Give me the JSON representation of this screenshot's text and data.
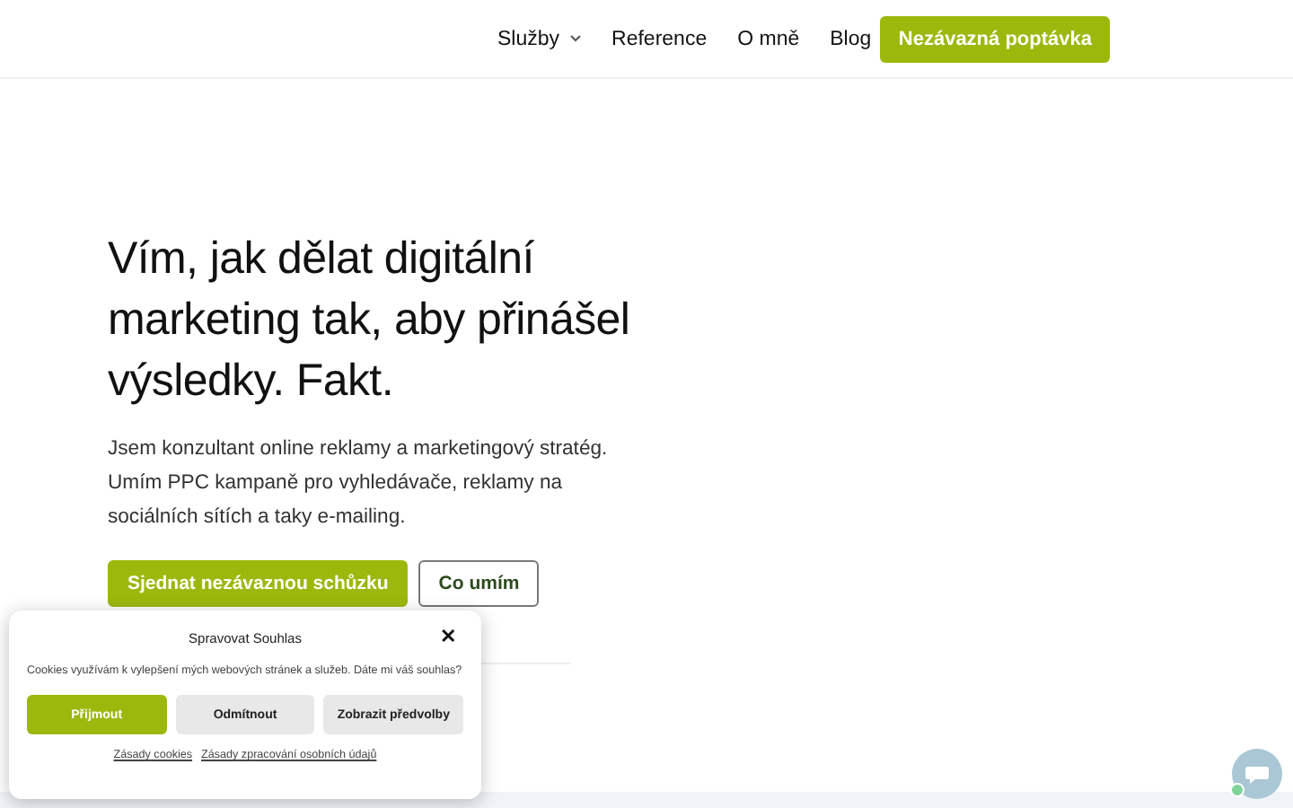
{
  "nav": {
    "items": [
      {
        "label": "Služby",
        "dropdown": true
      },
      {
        "label": "Reference",
        "dropdown": false
      },
      {
        "label": "O mně",
        "dropdown": false
      },
      {
        "label": "Blog",
        "dropdown": false
      }
    ],
    "cta": "Nezávazná poptávka"
  },
  "hero": {
    "heading": "Vím, jak dělat digitální marketing tak, aby přinášel výsledky. Fakt.",
    "text": "Jsem konzultant online reklamy a marketingový stratég. Umím PPC kampaně pro vyhledávače, reklamy na sociálních sítích a taky e-mailing.",
    "buttons": [
      {
        "label": "Sjednat nezávaznou schůzku",
        "kind": "primary"
      },
      {
        "label": "Co umím",
        "kind": "outline"
      }
    ]
  },
  "cookie_dialog": {
    "title": "Spravovat Souhlas",
    "close": "✕",
    "text": "Cookies využívám k vylepšení mých webových stránek a služeb. Dáte mi váš souhlas?",
    "buttons": [
      {
        "label": "Přijmout",
        "kind": "primary"
      },
      {
        "label": "Odmítnout",
        "kind": "secondary"
      },
      {
        "label": "Zobrazit předvolby",
        "kind": "secondary"
      }
    ],
    "links": [
      "Zásady cookies",
      "Zásady zpracování osobních údajů"
    ]
  }
}
